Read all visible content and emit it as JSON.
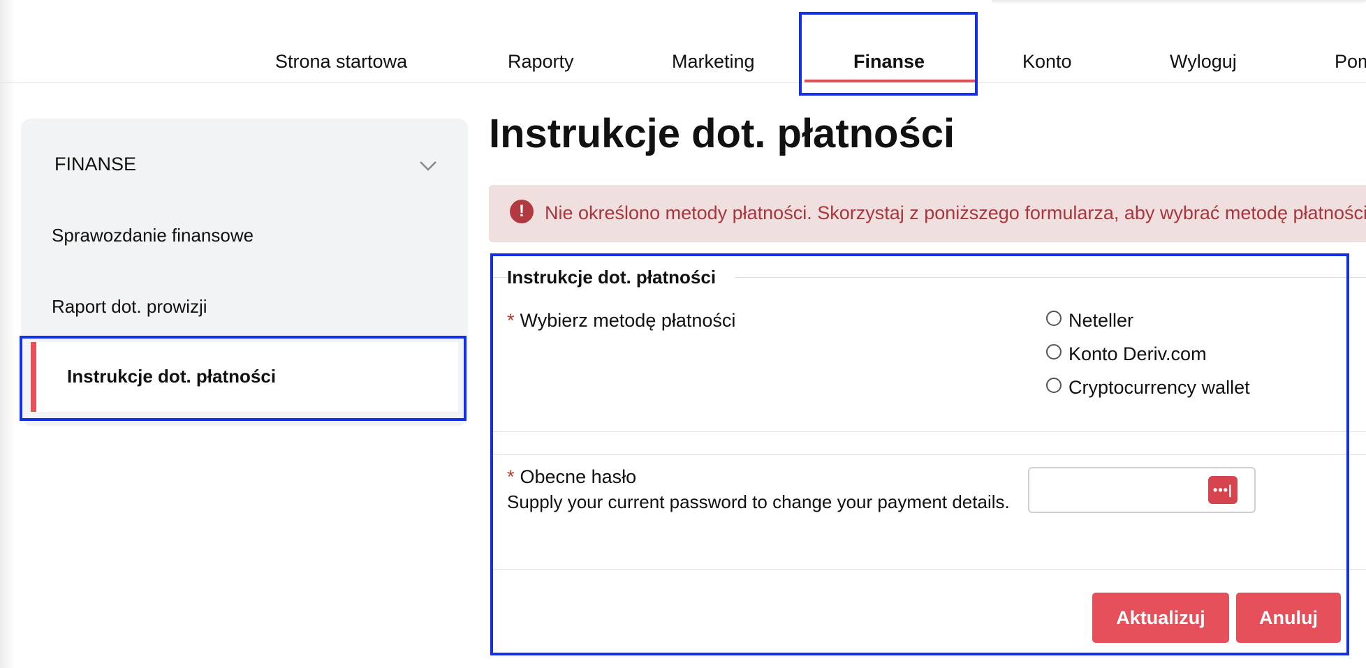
{
  "topnav": {
    "items": [
      {
        "label": "Strona startowa"
      },
      {
        "label": "Raporty"
      },
      {
        "label": "Marketing"
      },
      {
        "label": "Finanse",
        "active": true
      },
      {
        "label": "Konto"
      },
      {
        "label": "Wyloguj"
      },
      {
        "label": "Pom"
      }
    ]
  },
  "sidebar": {
    "header": "FINANSE",
    "items": [
      {
        "label": "Sprawozdanie finansowe"
      },
      {
        "label": "Raport dot. prowizji"
      },
      {
        "label": "Instrukcje dot. płatności",
        "active": true
      }
    ]
  },
  "main": {
    "title": "Instrukcje dot. płatności",
    "alert": {
      "icon": "exclamation-icon",
      "text": "Nie określono metody płatności. Skorzystaj z poniższego formularza, aby wybrać metodę płatności"
    },
    "form": {
      "legend": "Instrukcje dot. płatności",
      "required_mark": "*",
      "payment_method": {
        "label": "Wybierz metodę płatności",
        "options": [
          "Neteller",
          "Konto Deriv.com",
          "Cryptocurrency wallet"
        ]
      },
      "password": {
        "label": "Obecne hasło",
        "help": "Supply your current password to change your payment details.",
        "value": "",
        "icon": "password-manager-icon",
        "icon_text": "•••|"
      },
      "buttons": {
        "update": "Aktualizuj",
        "cancel": "Anuluj"
      }
    }
  },
  "colors": {
    "accent": "#e5505a",
    "alert_bg": "#f0dfdf",
    "alert_text": "#a8363c",
    "highlight": "#1430e6"
  }
}
